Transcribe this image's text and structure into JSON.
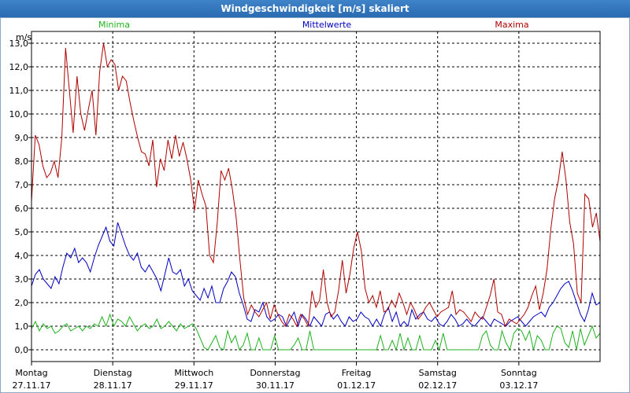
{
  "window": {
    "title": "Windgeschwindigkeit [m/s] skaliert"
  },
  "chart_data": {
    "type": "line",
    "ylabel": "m/s",
    "ylim": [
      -0.5,
      13.5
    ],
    "yticks": [
      "0,0",
      "1,0",
      "2,0",
      "3,0",
      "4,0",
      "5,0",
      "6,0",
      "7,0",
      "8,0",
      "9,0",
      "10,0",
      "11,0",
      "12,0",
      "13,0"
    ],
    "grid": true,
    "legend_position": "top",
    "x_start": "Montag 27.11.17",
    "x_end": "Sonntag 03.12.17 end",
    "x_days": 7,
    "x_labels": [
      {
        "day": "Montag",
        "date": "27.11.17"
      },
      {
        "day": "Dienstag",
        "date": "28.11.17"
      },
      {
        "day": "Mittwoch",
        "date": "29.11.17"
      },
      {
        "day": "Donnerstag",
        "date": "30.11.17"
      },
      {
        "day": "Freitag",
        "date": "01.12.17"
      },
      {
        "day": "Samstag",
        "date": "02.12.17"
      },
      {
        "day": "Sonntag",
        "date": "03.12.17"
      }
    ],
    "series": [
      {
        "name": "Minima",
        "color": "#1fb21f",
        "values": [
          0.9,
          1.2,
          0.8,
          1.1,
          0.9,
          1.0,
          0.7,
          0.8,
          1.0,
          1.1,
          0.8,
          0.9,
          1.0,
          0.8,
          1.0,
          0.9,
          1.1,
          1.0,
          1.4,
          1.0,
          1.5,
          1.0,
          1.3,
          1.2,
          1.0,
          1.4,
          1.1,
          0.8,
          1.0,
          1.1,
          0.9,
          1.0,
          1.3,
          0.9,
          1.0,
          1.2,
          1.0,
          0.8,
          1.1,
          0.9,
          1.0,
          1.1,
          0.9,
          0.5,
          0.1,
          0.0,
          0.3,
          0.6,
          0.1,
          0.0,
          0.8,
          0.3,
          0.6,
          0.0,
          0.2,
          0.7,
          0.0,
          0.0,
          0.5,
          0.0,
          0.0,
          0.0,
          0.6,
          0.0,
          0.0,
          0.0,
          0.0,
          0.2,
          0.5,
          0.0,
          0.0,
          0.8,
          0.0,
          0.0,
          0.0,
          0.0,
          0.0,
          0.0,
          0.0,
          0.0,
          0.0,
          0.0,
          0.0,
          0.0,
          0.0,
          0.0,
          0.0,
          0.0,
          0.0,
          0.6,
          0.0,
          0.0,
          0.4,
          0.0,
          0.7,
          0.0,
          0.5,
          0.0,
          0.0,
          0.6,
          0.0,
          0.0,
          0.0,
          0.4,
          0.0,
          0.7,
          0.0,
          0.0,
          0.0,
          0.0,
          0.0,
          0.0,
          0.0,
          0.0,
          0.0,
          0.6,
          0.8,
          0.2,
          0.0,
          0.0,
          0.8,
          0.3,
          0.0,
          0.7,
          0.9,
          0.8,
          0.4,
          0.8,
          0.0,
          0.6,
          0.4,
          0.0,
          0.0,
          0.7,
          1.0,
          0.9,
          0.3,
          0.1,
          0.8,
          0.0,
          0.9,
          0.2,
          0.6,
          1.0,
          0.5,
          0.7
        ]
      },
      {
        "name": "Mittelwerte",
        "color": "#0000c0",
        "values": [
          2.7,
          3.2,
          3.4,
          3.0,
          2.8,
          2.6,
          3.1,
          2.8,
          3.5,
          4.1,
          3.9,
          4.3,
          3.7,
          3.9,
          3.7,
          3.3,
          3.9,
          4.4,
          4.8,
          5.2,
          4.6,
          4.4,
          5.4,
          4.9,
          4.4,
          4.0,
          3.8,
          4.1,
          3.5,
          3.3,
          3.6,
          3.3,
          3.0,
          2.5,
          3.2,
          3.9,
          3.3,
          3.2,
          3.4,
          2.7,
          3.0,
          2.5,
          2.3,
          2.1,
          2.6,
          2.2,
          2.7,
          2.0,
          2.0,
          2.6,
          2.9,
          3.3,
          3.1,
          2.4,
          1.9,
          1.3,
          1.2,
          1.7,
          1.6,
          2.0,
          1.4,
          1.2,
          1.3,
          1.5,
          1.4,
          1.0,
          1.3,
          1.6,
          1.0,
          1.5,
          1.3,
          1.0,
          1.4,
          1.2,
          1.0,
          1.5,
          1.6,
          1.3,
          1.5,
          1.2,
          1.0,
          1.4,
          1.2,
          1.3,
          1.6,
          1.4,
          1.3,
          1.0,
          1.3,
          1.0,
          1.5,
          1.8,
          1.2,
          1.6,
          1.0,
          1.2,
          1.0,
          1.7,
          1.3,
          1.5,
          1.6,
          1.3,
          1.2,
          1.4,
          1.1,
          1.0,
          1.2,
          1.5,
          1.3,
          1.0,
          1.1,
          1.3,
          1.1,
          1.0,
          1.2,
          1.4,
          1.2,
          1.0,
          1.3,
          1.2,
          1.1,
          1.0,
          1.2,
          1.3,
          1.4,
          1.2,
          1.0,
          1.2,
          1.4,
          1.5,
          1.6,
          1.4,
          1.8,
          2.0,
          2.3,
          2.6,
          2.8,
          2.9,
          2.5,
          2.0,
          1.5,
          1.2,
          1.7,
          2.4,
          1.9,
          2.0
        ]
      },
      {
        "name": "Maxima",
        "color": "#b00000",
        "values": [
          6.3,
          9.1,
          8.7,
          7.8,
          7.3,
          7.5,
          8.0,
          7.3,
          9.0,
          12.8,
          11.0,
          9.2,
          11.6,
          10.0,
          9.3,
          10.2,
          11.0,
          9.1,
          11.8,
          13.0,
          12.0,
          12.3,
          12.1,
          11.0,
          11.6,
          11.4,
          10.5,
          9.7,
          9.0,
          8.4,
          8.3,
          7.8,
          8.9,
          6.9,
          8.1,
          7.6,
          8.9,
          8.1,
          9.1,
          8.2,
          8.8,
          8.1,
          7.2,
          5.9,
          7.2,
          6.6,
          6.1,
          4.0,
          3.7,
          5.4,
          7.6,
          7.2,
          7.7,
          6.8,
          5.6,
          3.8,
          2.2,
          1.5,
          1.9,
          1.6,
          1.4,
          1.7,
          2.0,
          1.3,
          1.9,
          1.5,
          1.2,
          1.0,
          1.5,
          1.3,
          1.0,
          1.5,
          1.3,
          1.0,
          2.5,
          1.8,
          2.1,
          3.4,
          2.0,
          1.4,
          1.6,
          2.5,
          3.8,
          2.4,
          3.2,
          4.3,
          5.0,
          4.2,
          2.6,
          2.0,
          2.3,
          1.8,
          2.5,
          1.6,
          1.7,
          2.1,
          1.8,
          2.4,
          2.0,
          1.5,
          2.0,
          1.7,
          1.3,
          1.5,
          1.8,
          2.0,
          1.7,
          1.4,
          1.6,
          1.7,
          1.8,
          2.5,
          1.5,
          1.7,
          1.6,
          1.4,
          1.2,
          1.6,
          1.4,
          1.3,
          1.8,
          2.3,
          3.0,
          1.6,
          1.5,
          1.0,
          1.3,
          1.2,
          1.1,
          1.3,
          1.5,
          1.8,
          2.3,
          2.7,
          1.7,
          2.4,
          3.4,
          5.1,
          6.4,
          7.2,
          8.4,
          7.2,
          5.4,
          4.5,
          2.4,
          2.0,
          6.6,
          6.4,
          5.2,
          5.8,
          4.6
        ]
      }
    ]
  }
}
